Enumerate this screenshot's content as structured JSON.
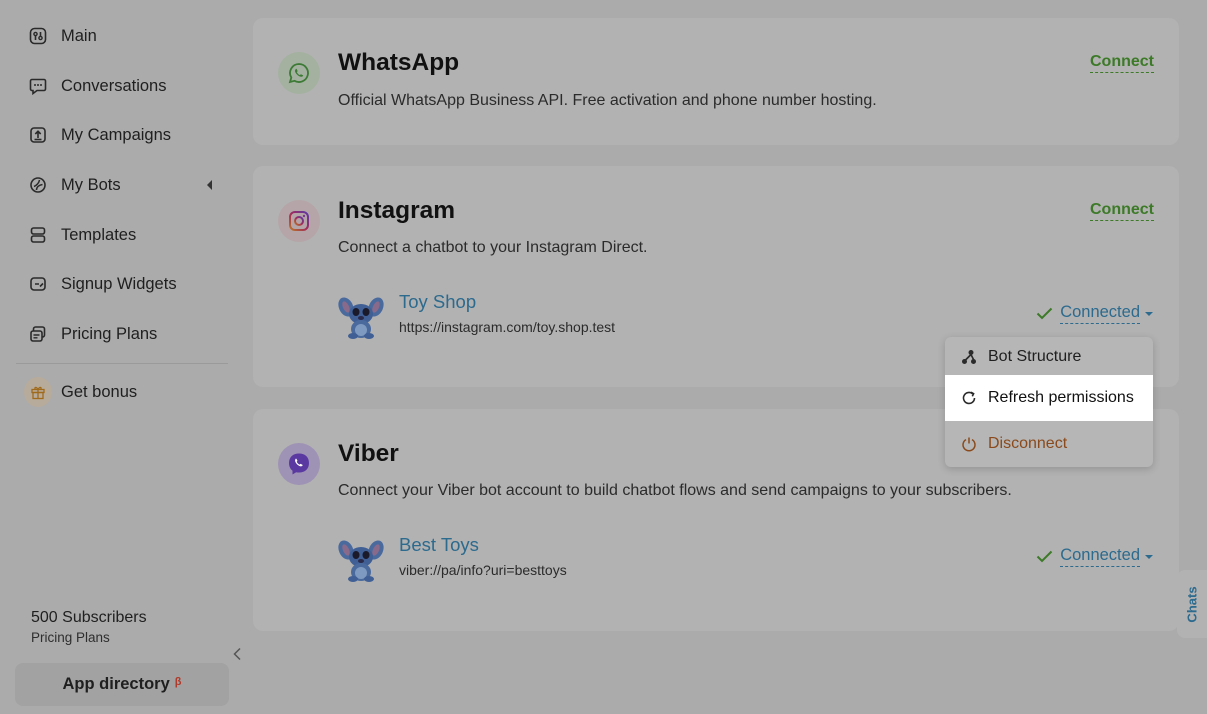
{
  "sidebar": {
    "items": [
      {
        "label": "Main",
        "icon": "main-icon"
      },
      {
        "label": "Conversations",
        "icon": "conversations-icon"
      },
      {
        "label": "My Campaigns",
        "icon": "campaigns-icon"
      },
      {
        "label": "My Bots",
        "icon": "bots-icon"
      },
      {
        "label": "Templates",
        "icon": "templates-icon"
      },
      {
        "label": "Signup Widgets",
        "icon": "widgets-icon"
      },
      {
        "label": "Pricing Plans",
        "icon": "pricing-icon"
      }
    ],
    "bonus_label": "Get bonus",
    "subscribers": "500 Subscribers",
    "pricing_link": "Pricing Plans",
    "app_directory": "App directory",
    "beta_mark": "β"
  },
  "channels": {
    "whatsapp": {
      "title": "WhatsApp",
      "description": "Official WhatsApp Business API. Free activation and phone number hosting.",
      "action": "Connect"
    },
    "instagram": {
      "title": "Instagram",
      "description": "Connect a chatbot to your Instagram Direct.",
      "action": "Connect",
      "bot": {
        "name": "Toy Shop",
        "url": "https://instagram.com/toy.shop.test",
        "status": "Connected"
      }
    },
    "viber": {
      "title": "Viber",
      "description": "Connect your Viber bot account to build chatbot flows and send campaigns to your subscribers.",
      "bot": {
        "name": "Best Toys",
        "url": "viber://pa/info?uri=besttoys",
        "status": "Connected"
      }
    }
  },
  "dropdown": {
    "items": [
      {
        "label": "Bot Structure",
        "icon": "bot-structure-icon"
      },
      {
        "label": "Refresh permissions",
        "icon": "refresh-icon"
      },
      {
        "label": "Disconnect",
        "icon": "power-icon"
      }
    ]
  },
  "chats_tab": "Chats",
  "colors": {
    "connect": "#3c7a28",
    "link": "#2c6a8e",
    "disconnect": "#8a4a1c",
    "beta": "#b03a2a"
  }
}
